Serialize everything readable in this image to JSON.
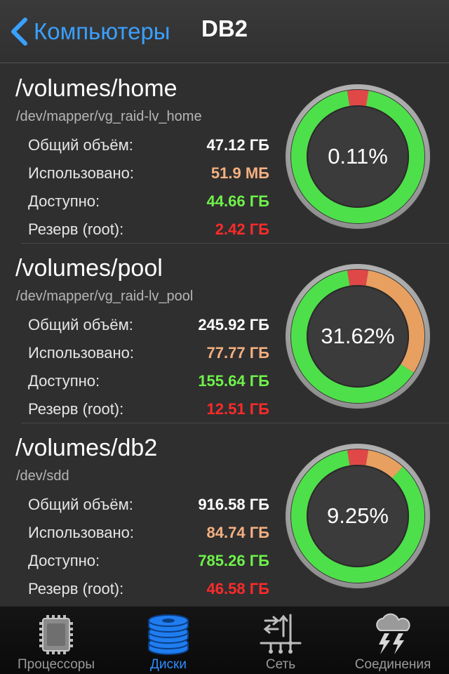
{
  "navbar": {
    "back_label": "Компьютеры",
    "title": "DB2"
  },
  "volumes": [
    {
      "mount": "/volumes/home",
      "device": "/dev/mapper/vg_raid-lv_home",
      "total_label": "Общий объём:",
      "total": "47.12 ГБ",
      "used_label": "Использовано:",
      "used": "51.9 МБ",
      "free_label": "Доступно:",
      "free": "44.66 ГБ",
      "reserve_label": "Резерв (root):",
      "reserve": "2.42 ГБ",
      "percent": "0.11%",
      "gauge": {
        "reserved_fraction": 0.0514,
        "used_fraction": 0.0011
      }
    },
    {
      "mount": "/volumes/pool",
      "device": "/dev/mapper/vg_raid-lv_pool",
      "total_label": "Общий объём:",
      "total": "245.92 ГБ",
      "used_label": "Использовано:",
      "used": "77.77 ГБ",
      "free_label": "Доступно:",
      "free": "155.64 ГБ",
      "reserve_label": "Резерв (root):",
      "reserve": "12.51 ГБ",
      "percent": "31.62%",
      "gauge": {
        "reserved_fraction": 0.0509,
        "used_fraction": 0.3162
      }
    },
    {
      "mount": "/volumes/db2",
      "device": "/dev/sdd",
      "total_label": "Общий объём:",
      "total": "916.58 ГБ",
      "used_label": "Использовано:",
      "used": "84.74 ГБ",
      "free_label": "Доступно:",
      "free": "785.26 ГБ",
      "reserve_label": "Резерв (root):",
      "reserve": "46.58 ГБ",
      "percent": "9.25%",
      "gauge": {
        "reserved_fraction": 0.0508,
        "used_fraction": 0.0925
      }
    }
  ],
  "tabs": [
    {
      "label": "Процессоры",
      "icon": "cpu-chip-icon",
      "active": false
    },
    {
      "label": "Диски",
      "icon": "disk-stack-icon",
      "active": true
    },
    {
      "label": "Сеть",
      "icon": "network-icon",
      "active": false
    },
    {
      "label": "Соединения",
      "icon": "storm-cloud-icon",
      "active": false
    }
  ],
  "colors": {
    "accent": "#2f8cff",
    "gauge_free": "#4ee04a",
    "gauge_used": "#e8a060",
    "gauge_reserved": "#e04848",
    "value_used": "#f5b080",
    "value_free": "#6ef24a",
    "value_reserved": "#ff2a2a"
  }
}
